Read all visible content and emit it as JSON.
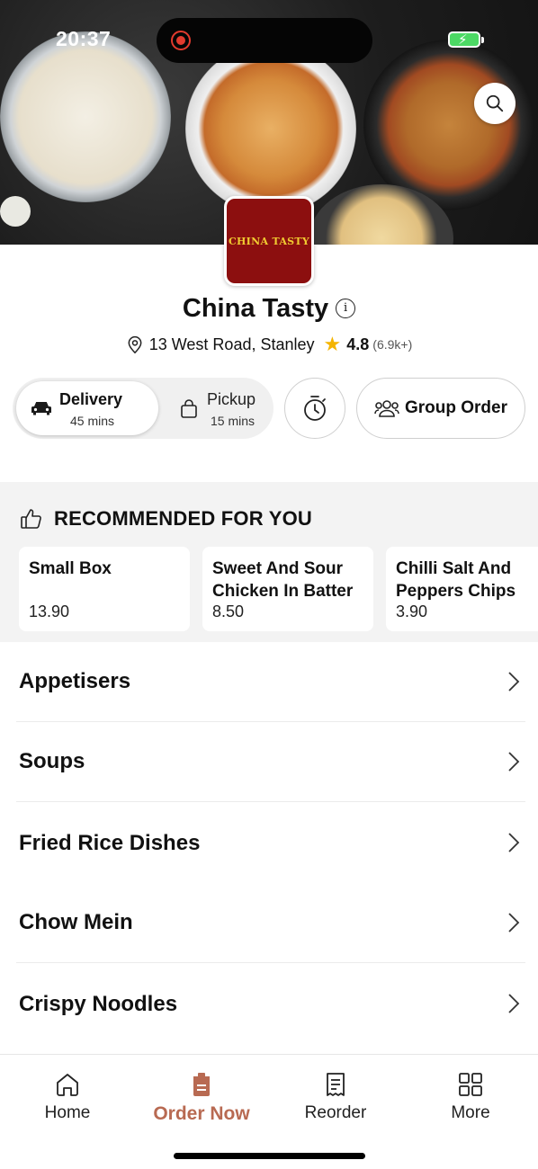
{
  "status_bar": {
    "time": "20:37"
  },
  "store": {
    "logo_text": "CHINA TASTY",
    "name": "China Tasty",
    "address": "13 West Road, Stanley",
    "rating": "4.8",
    "reviews": "(6.9k+)"
  },
  "order_mode": {
    "delivery": {
      "label": "Delivery",
      "time": "45 mins"
    },
    "pickup": {
      "label": "Pickup",
      "time": "15 mins"
    },
    "group_order_label": "Group Order"
  },
  "recommended": {
    "title": "RECOMMENDED FOR YOU",
    "items": [
      {
        "name": "Small Box",
        "price": "13.90"
      },
      {
        "name": "Sweet And Sour Chicken In Batter",
        "price": "8.50"
      },
      {
        "name": "Chilli Salt And Peppers Chips",
        "price": "3.90"
      }
    ]
  },
  "menu": {
    "categories": [
      {
        "label": "Appetisers"
      },
      {
        "label": "Soups"
      },
      {
        "label": "Fried Rice Dishes"
      },
      {
        "label": "Chow Mein"
      },
      {
        "label": "Crispy Noodles"
      }
    ]
  },
  "tab_bar": {
    "tabs": [
      {
        "label": "Home",
        "icon": "home-icon"
      },
      {
        "label": "Order Now",
        "icon": "order-bag-icon"
      },
      {
        "label": "Reorder",
        "icon": "receipt-icon"
      },
      {
        "label": "More",
        "icon": "grid-icon"
      }
    ],
    "active_color": "#b86a52"
  },
  "colors": {
    "brand_red": "#8c0f0f",
    "logo_text": "#f1cc31",
    "star": "#f4b400"
  }
}
